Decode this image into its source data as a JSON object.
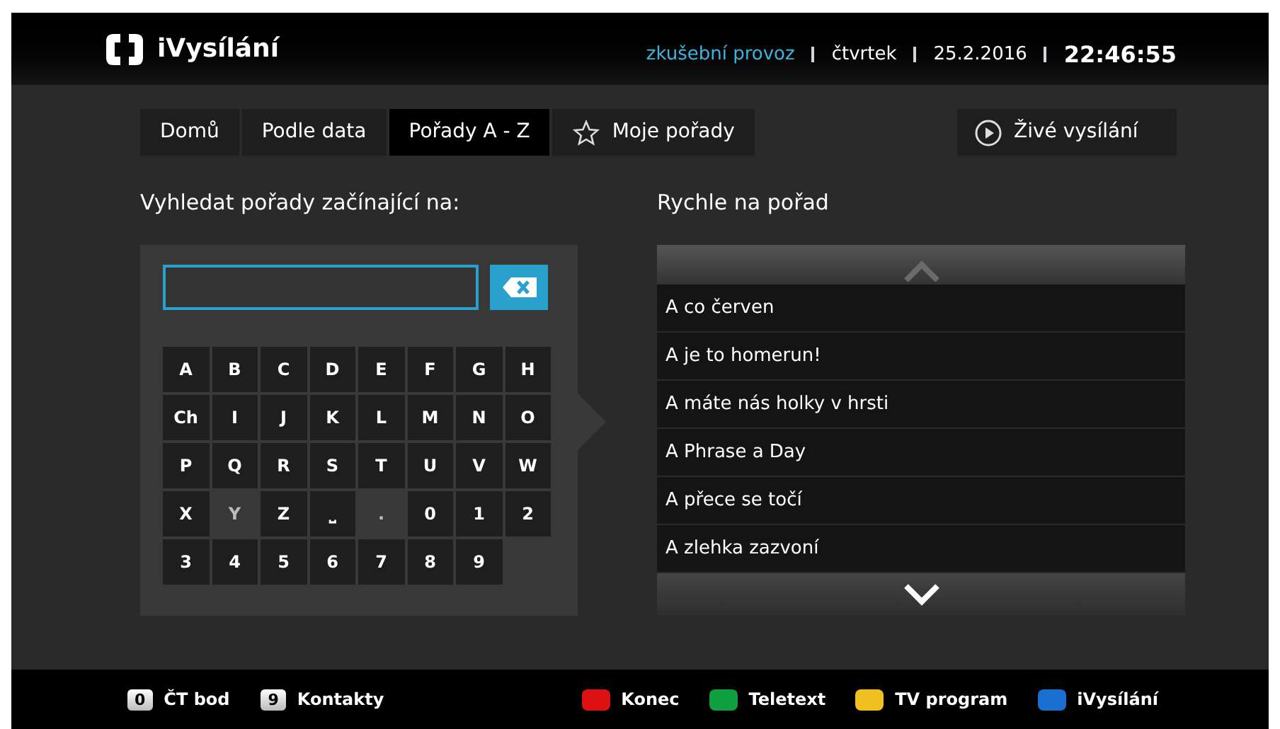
{
  "header": {
    "logo": "iVysílání",
    "mode": "zkušební provoz",
    "day": "čtvrtek",
    "date": "25.2.2016",
    "time": "22:46:55"
  },
  "tabs": [
    {
      "label": "Domů",
      "selected": false,
      "kind": "plain"
    },
    {
      "label": "Podle data",
      "selected": false,
      "kind": "plain"
    },
    {
      "label": "Pořady A - Z",
      "selected": true,
      "kind": "plain"
    },
    {
      "label": "Moje pořady",
      "selected": false,
      "kind": "star"
    }
  ],
  "live_button": "Živé vysílání",
  "search": {
    "heading": "Vyhledat pořady začínající na:"
  },
  "keys": [
    {
      "label": "A",
      "disabled": false
    },
    {
      "label": "B",
      "disabled": false
    },
    {
      "label": "C",
      "disabled": false
    },
    {
      "label": "D",
      "disabled": false
    },
    {
      "label": "E",
      "disabled": false
    },
    {
      "label": "F",
      "disabled": false
    },
    {
      "label": "G",
      "disabled": false
    },
    {
      "label": "H",
      "disabled": false
    },
    {
      "label": "Ch",
      "disabled": false
    },
    {
      "label": "I",
      "disabled": false
    },
    {
      "label": "J",
      "disabled": false
    },
    {
      "label": "K",
      "disabled": false
    },
    {
      "label": "L",
      "disabled": false
    },
    {
      "label": "M",
      "disabled": false
    },
    {
      "label": "N",
      "disabled": false
    },
    {
      "label": "O",
      "disabled": false
    },
    {
      "label": "P",
      "disabled": false
    },
    {
      "label": "Q",
      "disabled": false
    },
    {
      "label": "R",
      "disabled": false
    },
    {
      "label": "S",
      "disabled": false
    },
    {
      "label": "T",
      "disabled": false
    },
    {
      "label": "U",
      "disabled": false
    },
    {
      "label": "V",
      "disabled": false
    },
    {
      "label": "W",
      "disabled": false
    },
    {
      "label": "X",
      "disabled": false
    },
    {
      "label": "Y",
      "disabled": true
    },
    {
      "label": "Z",
      "disabled": false
    },
    {
      "label": "⎵",
      "disabled": false
    },
    {
      "label": ".",
      "disabled": true
    },
    {
      "label": "0",
      "disabled": false
    },
    {
      "label": "1",
      "disabled": false
    },
    {
      "label": "2",
      "disabled": false
    },
    {
      "label": "3",
      "disabled": false
    },
    {
      "label": "4",
      "disabled": false
    },
    {
      "label": "5",
      "disabled": false
    },
    {
      "label": "6",
      "disabled": false
    },
    {
      "label": "7",
      "disabled": false
    },
    {
      "label": "8",
      "disabled": false
    },
    {
      "label": "9",
      "disabled": false
    }
  ],
  "quick": {
    "heading": "Rychle na pořad",
    "up_disabled": true,
    "down_disabled": false,
    "items": [
      "A co červen",
      "A je to homerun!",
      "A máte nás holky v hrsti",
      "A Phrase a Day",
      "A přece se točí",
      "A zlehka zazvoní"
    ]
  },
  "footer": {
    "left": [
      {
        "key": "0",
        "label": "ČT bod"
      },
      {
        "key": "9",
        "label": "Kontakty"
      }
    ],
    "right": [
      {
        "color": "#dd1111",
        "label": "Konec"
      },
      {
        "color": "#10a040",
        "label": "Teletext"
      },
      {
        "color": "#f0c020",
        "label": "TV program"
      },
      {
        "color": "#1a6fd0",
        "label": "iVysílání"
      }
    ]
  }
}
